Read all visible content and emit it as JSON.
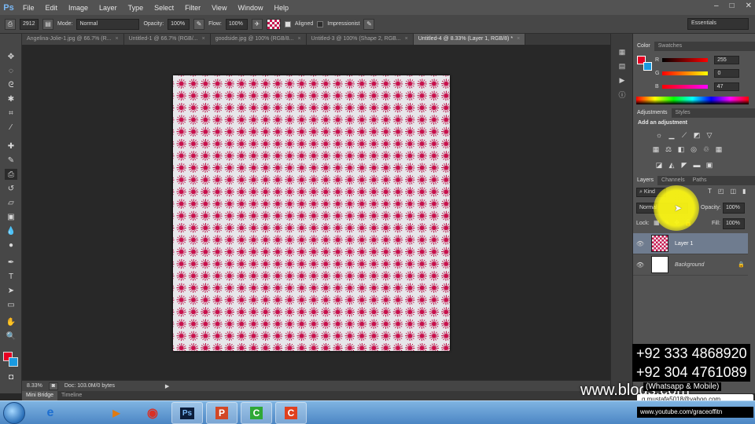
{
  "app": {
    "logo": "Ps"
  },
  "menu": [
    "File",
    "Edit",
    "Image",
    "Layer",
    "Type",
    "Select",
    "Filter",
    "View",
    "Window",
    "Help"
  ],
  "window_controls": [
    "–",
    "□",
    "✕"
  ],
  "options": {
    "brush_size": "2912",
    "mode_label": "Mode:",
    "mode_value": "Normal",
    "opacity_label": "Opacity:",
    "opacity_value": "100%",
    "flow_label": "Flow:",
    "flow_value": "100%",
    "aligned_label": "Aligned",
    "aligned_checked": true,
    "impressionist_label": "Impressionist",
    "impressionist_checked": false,
    "workspace": "Essentials"
  },
  "tabs": [
    {
      "label": "Angelina-Jolie-1.jpg @ 66.7% (R...",
      "active": false
    },
    {
      "label": "Untitled-1 @ 66.7% (RGB/...",
      "active": false
    },
    {
      "label": "goodside.jpg @ 100% (RGB/8...",
      "active": false
    },
    {
      "label": "Untitled-3 @ 100% (Shape 2, RGB...",
      "active": false
    },
    {
      "label": "Untitled-4 @ 8.33% (Layer 1, RGB/8) *",
      "active": true
    }
  ],
  "status": {
    "zoom": "8.33%",
    "doc_info": "Doc: 103.0M/0 bytes"
  },
  "bottom_tabs": [
    "Mini Bridge",
    "Timeline"
  ],
  "color_panel": {
    "tabs": [
      "Color",
      "Swatches"
    ],
    "channels": [
      {
        "label": "R",
        "value": "255"
      },
      {
        "label": "G",
        "value": "0"
      },
      {
        "label": "B",
        "value": "47"
      }
    ],
    "foreground": "#e60023",
    "background": "#1a9ae0"
  },
  "adjustments_panel": {
    "tabs": [
      "Adjustments",
      "Styles"
    ],
    "heading": "Add an adjustment"
  },
  "layers_panel": {
    "tabs": [
      "Layers",
      "Channels",
      "Paths"
    ],
    "filter_kind": "Kind",
    "blend_mode": "Normal",
    "opacity_label": "Opacity:",
    "opacity_value": "100%",
    "lock_label": "Lock:",
    "fill_label": "Fill:",
    "fill_value": "100%",
    "layers": [
      {
        "name": "Layer 1",
        "selected": true
      },
      {
        "name": "Background",
        "selected": false
      }
    ]
  },
  "overlay": {
    "phones": [
      "+92 333 4868920",
      "+92 304 4761089"
    ],
    "whatsapp": "(Whatsapp & Mobile)",
    "website": "www.blogs.com",
    "email": "g.mustafa5018@yahoo.com",
    "youtube": "www.youtube.com/graceoffitn"
  },
  "taskbar": [
    {
      "name": "internet-explorer",
      "glyph": "e",
      "color": "#1e6fd1"
    },
    {
      "name": "media-player",
      "glyph": "▶",
      "color": "#e07a10"
    },
    {
      "name": "chrome",
      "glyph": "◉",
      "color": "#d93025"
    },
    {
      "name": "photoshop",
      "glyph": "Ps",
      "color": "#7ab8f5"
    },
    {
      "name": "powerpoint",
      "glyph": "P",
      "color": "#d24726"
    },
    {
      "name": "camtasia-green",
      "glyph": "C",
      "color": "#2fa836"
    },
    {
      "name": "camtasia-red",
      "glyph": "C",
      "color": "#e0401e"
    }
  ]
}
